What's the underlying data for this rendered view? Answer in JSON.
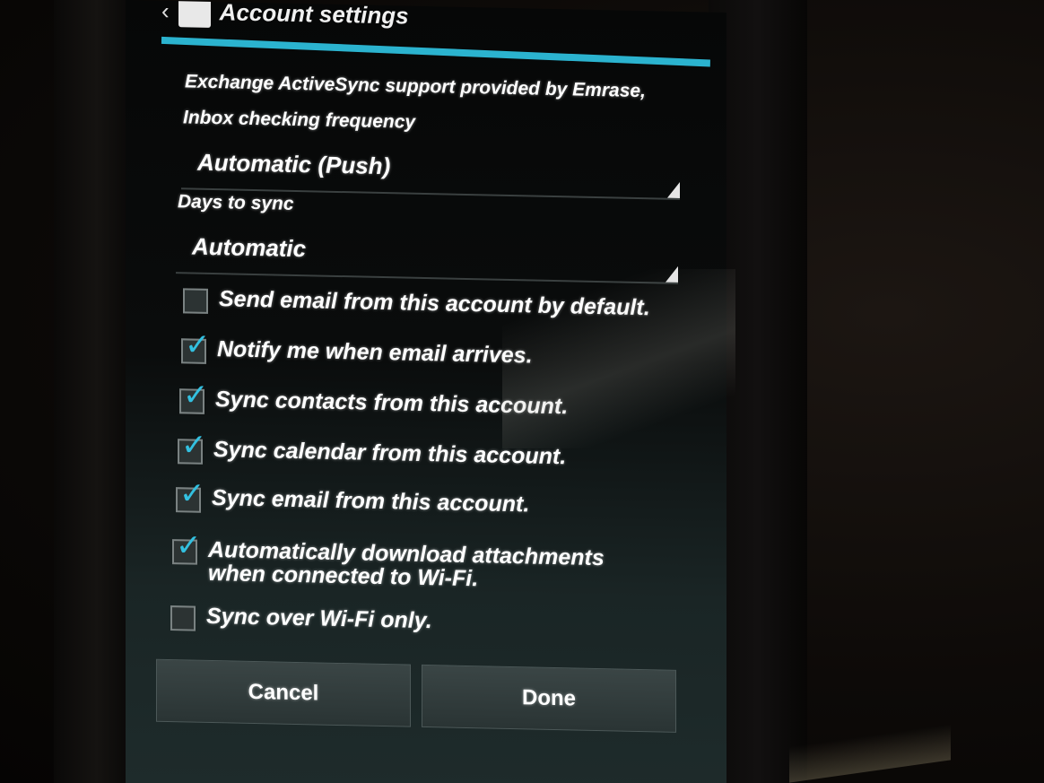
{
  "header": {
    "title": "Account settings"
  },
  "provider_text": "Exchange ActiveSync support provided by Emrase,",
  "inbox_frequency": {
    "label": "Inbox checking frequency",
    "value": "Automatic (Push)"
  },
  "days_to_sync": {
    "label": "Days to sync",
    "value": "Automatic"
  },
  "options": [
    {
      "label": "Send email from this account by default.",
      "checked": false
    },
    {
      "label": "Notify me when email arrives.",
      "checked": true
    },
    {
      "label": "Sync contacts from this account.",
      "checked": true
    },
    {
      "label": "Sync calendar from this account.",
      "checked": true
    },
    {
      "label": "Sync email from this account.",
      "checked": true
    },
    {
      "label": "Automatically download attachments when connected to Wi-Fi.",
      "checked": true
    },
    {
      "label": "Sync over Wi-Fi only.",
      "checked": false
    }
  ],
  "buttons": {
    "cancel": "Cancel",
    "done": "Done"
  },
  "colors": {
    "accent": "#2bb3cf",
    "check": "#33c0e0"
  }
}
